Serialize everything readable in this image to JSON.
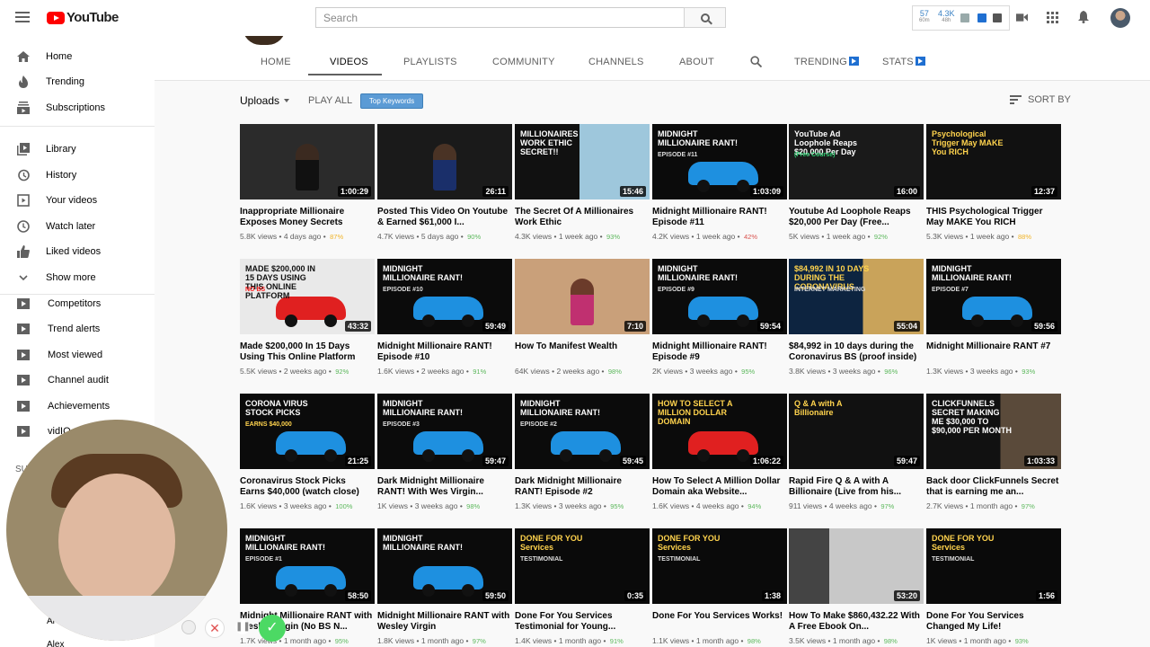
{
  "header": {
    "logo": "YouTube",
    "search_placeholder": "Search",
    "vidiq": {
      "stat1_value": "57",
      "stat1_label": "60m",
      "stat2_value": "4.3K",
      "stat2_label": "48h"
    }
  },
  "sidebar": {
    "items": [
      {
        "label": "Home",
        "icon": "home-icon"
      },
      {
        "label": "Trending",
        "icon": "fire-icon"
      },
      {
        "label": "Subscriptions",
        "icon": "subscriptions-icon"
      },
      {
        "label": "Library",
        "icon": "library-icon"
      },
      {
        "label": "History",
        "icon": "history-icon"
      },
      {
        "label": "Your videos",
        "icon": "play-box-icon"
      },
      {
        "label": "Watch later",
        "icon": "clock-icon"
      },
      {
        "label": "Liked videos",
        "icon": "thumbs-up-icon"
      },
      {
        "label": "Show more",
        "icon": "chevron-down-icon"
      }
    ],
    "vidiq_items": [
      {
        "label": "Competitors"
      },
      {
        "label": "Trend alerts"
      },
      {
        "label": "Most viewed"
      },
      {
        "label": "Channel audit"
      },
      {
        "label": "Achievements"
      },
      {
        "label": "vidIQ"
      }
    ],
    "section_partial": "SU",
    "bottom_partial_1": "Al",
    "bottom_partial_2": "Alex"
  },
  "channel_tabs": {
    "home": "HOME",
    "videos": "VIDEOS",
    "playlists": "PLAYLISTS",
    "community": "COMMUNITY",
    "channels": "CHANNELS",
    "about": "ABOUT",
    "trending": "TRENDING",
    "stats": "STATS"
  },
  "toolbar": {
    "uploads": "Uploads",
    "play_all": "PLAY ALL",
    "top_keywords": "Top Keywords",
    "sort_by": "SORT BY"
  },
  "videos": [
    {
      "title": "Inappropriate Millionaire Exposes Money Secrets",
      "duration": "1:00:29",
      "views": "5.8K views",
      "age": "4 days ago",
      "score": "87%",
      "score_color": "#f0b429"
    },
    {
      "title": "Posted This Video On Youtube & Earned $61,000 I...",
      "duration": "26:11",
      "views": "4.7K views",
      "age": "5 days ago",
      "score": "90%",
      "score_color": "#5cb85c"
    },
    {
      "title": "The Secret Of A Millionaires Work Ethic",
      "duration": "15:46",
      "views": "4.3K views",
      "age": "1 week ago",
      "score": "93%",
      "score_color": "#5cb85c",
      "thumb_text": "MILLIONAIRES WORK ETHIC SECRET!!"
    },
    {
      "title": "Midnight Millionaire RANT! Episode #11",
      "duration": "1:03:09",
      "views": "4.2K views",
      "age": "1 week ago",
      "score": "42%",
      "score_color": "#d9534f",
      "thumb_text": "MIDNIGHT MILLIONAIRE RANT!",
      "thumb_sub": "EPISODE #11"
    },
    {
      "title": "Youtube Ad Loophole Reaps $20,000 Per Day (Free...",
      "duration": "16:00",
      "views": "5K views",
      "age": "1 week ago",
      "score": "92%",
      "score_color": "#5cb85c",
      "thumb_text": "YouTube Ad Loophole Reaps $20,000 Per Day",
      "thumb_sub": "(Free Course)"
    },
    {
      "title": "THIS Psychological Trigger May MAKE You RICH",
      "duration": "12:37",
      "views": "5.3K views",
      "age": "1 week ago",
      "score": "88%",
      "score_color": "#f0b429",
      "thumb_text": "Psychological Trigger May MAKE You RICH"
    },
    {
      "title": "Made $200,000 In 15 Days Using This Online Platform",
      "duration": "43:32",
      "views": "5.5K views",
      "age": "2 weeks ago",
      "score": "92%",
      "score_color": "#5cb85c",
      "thumb_text": "MADE $200,000 IN 15 DAYS USING THIS ONLINE PLATFORM",
      "thumb_sub": "NO BS"
    },
    {
      "title": "Midnight Millionaire RANT! Episode #10",
      "duration": "59:49",
      "views": "1.6K views",
      "age": "2 weeks ago",
      "score": "91%",
      "score_color": "#5cb85c",
      "thumb_text": "MIDNIGHT MILLIONAIRE RANT!",
      "thumb_sub": "EPISODE #10"
    },
    {
      "title": "How To Manifest Wealth",
      "duration": "7:10",
      "views": "64K views",
      "age": "2 weeks ago",
      "score": "98%",
      "score_color": "#5cb85c"
    },
    {
      "title": "Midnight Millionaire RANT! Episode #9",
      "duration": "59:54",
      "views": "2K views",
      "age": "3 weeks ago",
      "score": "95%",
      "score_color": "#5cb85c",
      "thumb_text": "MIDNIGHT MILLIONAIRE RANT!",
      "thumb_sub": "EPISODE #9"
    },
    {
      "title": "$84,992 in 10 days during the Coronavirus BS (proof inside)",
      "duration": "55:04",
      "views": "3.8K views",
      "age": "3 weeks ago",
      "score": "96%",
      "score_color": "#5cb85c",
      "thumb_text": "$84,992 IN 10 DAYS DURING THE CORONAVIRUS",
      "thumb_sub": "INTERNET MARKETING"
    },
    {
      "title": "Midnight Millionaire RANT #7",
      "duration": "59:56",
      "views": "1.3K views",
      "age": "3 weeks ago",
      "score": "93%",
      "score_color": "#5cb85c",
      "thumb_text": "MIDNIGHT MILLIONAIRE RANT!",
      "thumb_sub": "EPISODE #7"
    },
    {
      "title": "Coronavirus Stock Picks Earns $40,000 (watch close)",
      "duration": "21:25",
      "views": "1.6K views",
      "age": "3 weeks ago",
      "score": "100%",
      "score_color": "#5cb85c",
      "thumb_text": "CORONA VIRUS STOCK PICKS",
      "thumb_sub": "EARNS $40,000"
    },
    {
      "title": "Dark Midnight Millionaire RANT! With Wes Virgin...",
      "duration": "59:47",
      "views": "1K views",
      "age": "3 weeks ago",
      "score": "98%",
      "score_color": "#5cb85c",
      "thumb_text": "MIDNIGHT MILLIONAIRE RANT!",
      "thumb_sub": "EPISODE #3"
    },
    {
      "title": "Dark Midnight Millionaire RANT! Episode #2",
      "duration": "59:45",
      "views": "1.3K views",
      "age": "3 weeks ago",
      "score": "95%",
      "score_color": "#5cb85c",
      "thumb_text": "MIDNIGHT MILLIONAIRE RANT!",
      "thumb_sub": "EPISODE #2"
    },
    {
      "title": "How To Select A Million Dollar Domain aka Website...",
      "duration": "1:06:22",
      "views": "1.6K views",
      "age": "4 weeks ago",
      "score": "94%",
      "score_color": "#5cb85c",
      "thumb_text": "HOW TO SELECT A MILLION DOLLAR DOMAIN"
    },
    {
      "title": "Rapid Fire Q & A with A Billionaire (Live from his...",
      "duration": "59:47",
      "views": "911 views",
      "age": "4 weeks ago",
      "score": "97%",
      "score_color": "#5cb85c",
      "thumb_text": "Q & A with A Billionaire"
    },
    {
      "title": "Back door ClickFunnels Secret that is earning me an...",
      "duration": "1:03:33",
      "views": "2.7K views",
      "age": "1 month ago",
      "score": "97%",
      "score_color": "#5cb85c",
      "thumb_text": "CLICKFUNNELS SECRET MAKING ME $30,000 TO $90,000 PER MONTH"
    },
    {
      "title": "Midnight Millionaire RANT with Wesley Virgin (No BS N...",
      "duration": "58:50",
      "views": "1.7K views",
      "age": "1 month ago",
      "score": "95%",
      "score_color": "#5cb85c",
      "thumb_text": "MIDNIGHT MILLIONAIRE RANT!",
      "thumb_sub": "EPISODE #1"
    },
    {
      "title": "Midnight Millionaire RANT with Wesley Virgin",
      "duration": "59:50",
      "views": "1.8K views",
      "age": "1 month ago",
      "score": "97%",
      "score_color": "#5cb85c",
      "thumb_text": "MIDNIGHT MILLIONAIRE RANT!"
    },
    {
      "title": "Done For You Services Testimonial for Young...",
      "duration": "0:35",
      "views": "1.4K views",
      "age": "1 month ago",
      "score": "91%",
      "score_color": "#5cb85c",
      "thumb_text": "DONE FOR YOU Services",
      "thumb_sub": "TESTIMONIAL"
    },
    {
      "title": "Done For You Services Works!",
      "duration": "1:38",
      "views": "1.1K views",
      "age": "1 month ago",
      "score": "98%",
      "score_color": "#5cb85c",
      "thumb_text": "DONE FOR YOU Services",
      "thumb_sub": "TESTIMONIAL"
    },
    {
      "title": "How To Make $860,432.22 With A Free Ebook On...",
      "duration": "53:20",
      "views": "3.5K views",
      "age": "1 month ago",
      "score": "98%",
      "score_color": "#5cb85c"
    },
    {
      "title": "Done For You Services Changed My Life!",
      "duration": "1:56",
      "views": "1K views",
      "age": "1 month ago",
      "score": "93%",
      "score_color": "#5cb85c",
      "thumb_text": "DONE FOR YOU Services",
      "thumb_sub": "TESTIMONIAL"
    }
  ]
}
